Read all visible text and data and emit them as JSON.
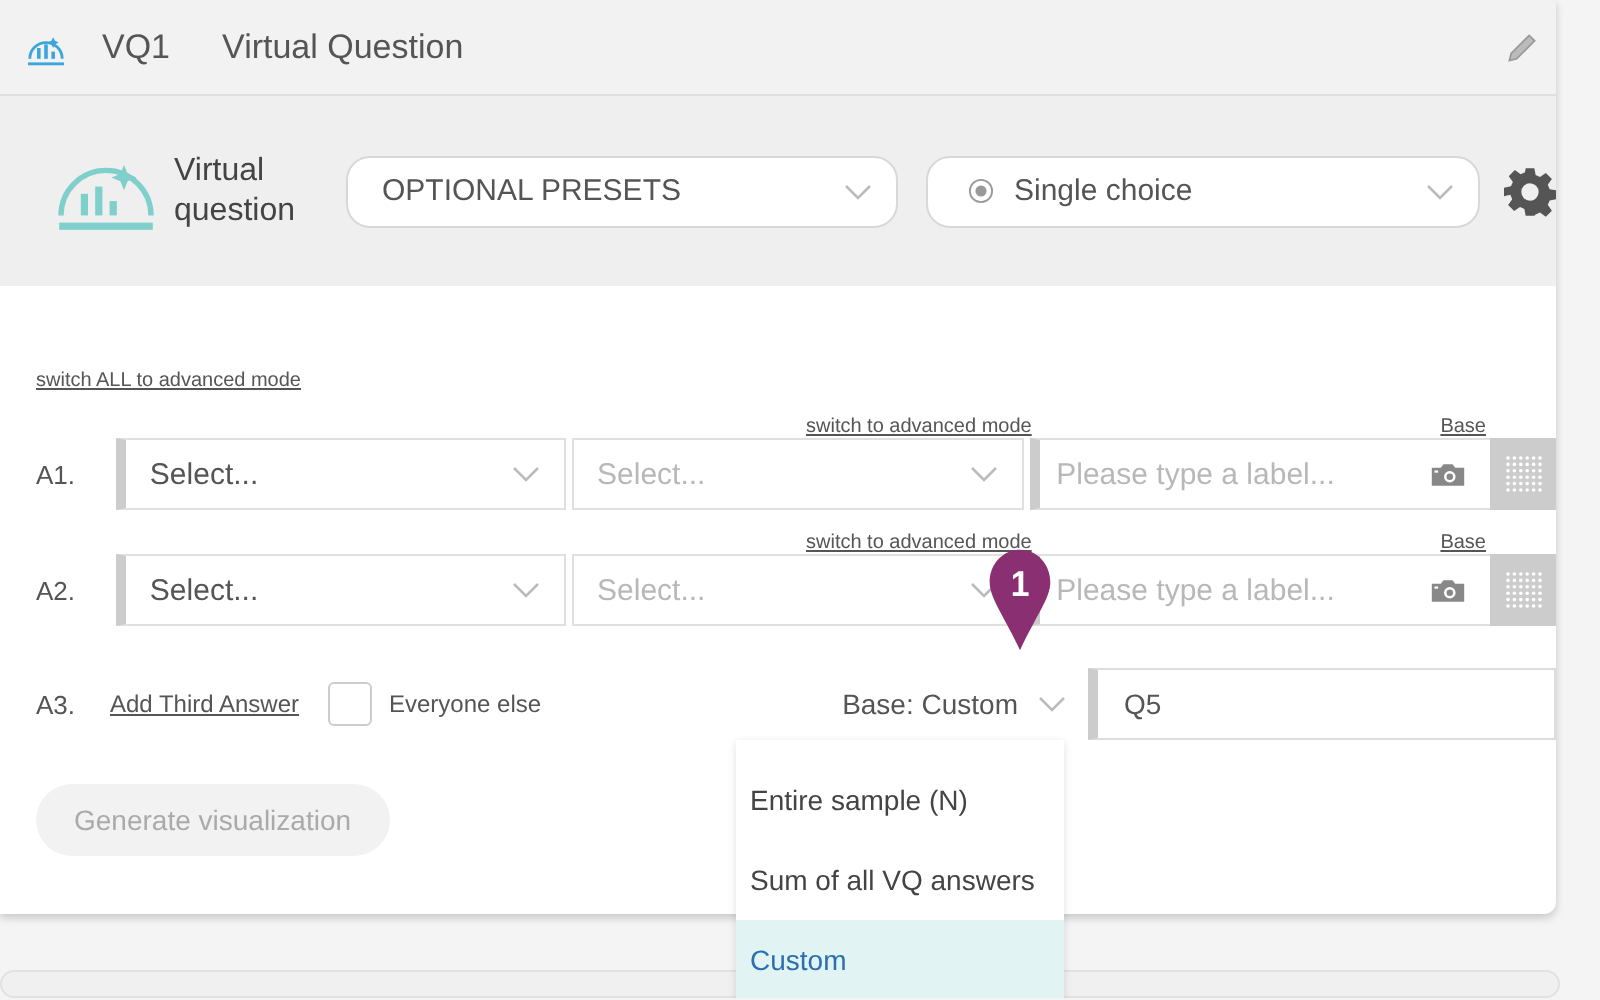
{
  "header": {
    "code": "VQ1",
    "title": "Virtual Question"
  },
  "toolbar": {
    "logo_text": "Virtual question",
    "presets": {
      "value": "OPTIONAL PRESETS"
    },
    "question_type": {
      "value": "Single choice"
    }
  },
  "switch_all_link": "switch ALL to advanced mode",
  "answers": [
    {
      "label": "A1.",
      "switch_link": "switch to advanced mode",
      "base_link": "Base",
      "selects": [
        {
          "placeholder": "Select...",
          "disabled": false
        },
        {
          "placeholder": "Select...",
          "disabled": true
        }
      ],
      "label_placeholder": "Please type a label..."
    },
    {
      "label": "A2.",
      "switch_link": "switch to advanced mode",
      "base_link": "Base",
      "selects": [
        {
          "placeholder": "Select...",
          "disabled": false
        },
        {
          "placeholder": "Select...",
          "disabled": true
        }
      ],
      "label_placeholder": "Please type a label..."
    }
  ],
  "third": {
    "label": "A3.",
    "add_link": "Add Third Answer",
    "everyone_else": {
      "label": "Everyone else",
      "checked": false
    },
    "base": {
      "value": "Base: Custom"
    },
    "custom_value": "Q5"
  },
  "base_menu": [
    {
      "label": "Entire sample (N)",
      "selected": false
    },
    {
      "label": "Sum of all VQ answers",
      "selected": false
    },
    {
      "label": "Custom",
      "selected": true
    }
  ],
  "generate_button": {
    "label": "Generate visualization",
    "disabled": true
  },
  "marker": {
    "number": "1"
  }
}
